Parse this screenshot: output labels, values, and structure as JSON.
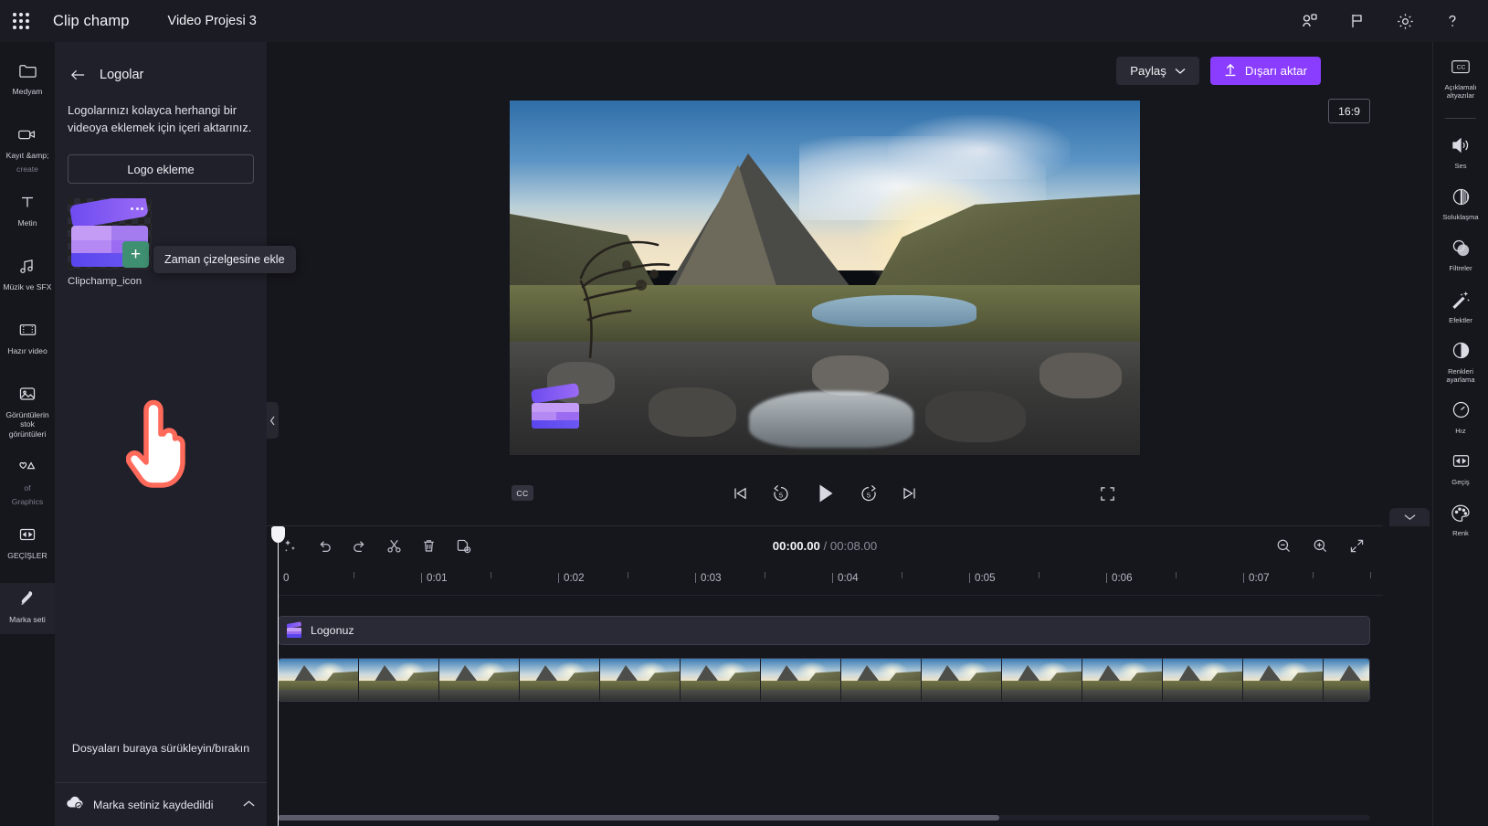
{
  "header": {
    "brand": "Clip champ",
    "project_name": "Video Projesi 3",
    "icons": [
      {
        "name": "collaborate-icon",
        "glyph": "share-people"
      },
      {
        "name": "flag-icon",
        "glyph": "flag"
      },
      {
        "name": "gear-icon",
        "glyph": "gear"
      },
      {
        "name": "help-icon",
        "glyph": "?"
      }
    ]
  },
  "left_rail": {
    "items": [
      {
        "label": "Medyam",
        "icon": "folder-icon",
        "active": false,
        "dim": false
      },
      {
        "label": "Kayıt &amp; create",
        "icon": "camera-icon",
        "active": false,
        "dim": true
      },
      {
        "label": "Metin",
        "icon": "text-icon",
        "active": false,
        "dim": false
      },
      {
        "label": "Müzik ve SFX",
        "icon": "music-icon",
        "active": false,
        "dim": false
      },
      {
        "label": "Hazır video",
        "icon": "film-icon",
        "active": false,
        "dim": false
      },
      {
        "label": "Görüntülerin stok görüntüleri",
        "icon": "image-icon",
        "active": false,
        "dim": false
      },
      {
        "label": "of Graphics",
        "icon": "shapes-icon",
        "active": false,
        "dim": true
      },
      {
        "label": "GEÇİŞLER",
        "icon": "transition-icon",
        "active": false,
        "dim": false
      },
      {
        "label": "Marka seti",
        "icon": "brandkit-icon",
        "active": true,
        "dim": false
      }
    ],
    "kayit_line1": "Kayıt &amp;",
    "kayit_line2": "create",
    "graphics_line1": "of",
    "graphics_line2": "Graphics"
  },
  "panel": {
    "title": "Logolar",
    "description": "Logolarınızı kolayca herhangi bir videoya eklemek için içeri aktarınız.",
    "add_logo_label": "Logo ekleme",
    "asset_name": "Clipchamp_icon",
    "tooltip": "Zaman çizelgesine ekle",
    "drop_hint": "Dosyaları buraya sürükleyin/bırakın",
    "brand_saved": "Marka setiniz kaydedildi"
  },
  "stage": {
    "share_label": "Paylaş",
    "export_label": "Dışarı aktar",
    "aspect_ratio": "16:9",
    "cc_label": "CC",
    "transport": [
      {
        "name": "skip-to-start-button"
      },
      {
        "name": "rewind-5s-button",
        "value": "5"
      },
      {
        "name": "play-button"
      },
      {
        "name": "forward-5s-button",
        "value": "5"
      },
      {
        "name": "skip-to-end-button"
      }
    ]
  },
  "right_rail": {
    "items": [
      {
        "label": "Açıklamalı altyazılar",
        "icon": "closed-caption-icon"
      },
      {
        "label": "Ses",
        "icon": "speaker-icon"
      },
      {
        "label": "Soluklaşma",
        "icon": "fade-icon"
      },
      {
        "label": "Filtreler",
        "icon": "filters-icon"
      },
      {
        "label": "Efektler",
        "icon": "effects-icon"
      },
      {
        "label": "Renkleri ayarlama",
        "icon": "adjust-colors-icon"
      },
      {
        "label": "Hız",
        "icon": "speed-icon"
      },
      {
        "label": "Geçiş",
        "icon": "transition-icon"
      },
      {
        "label": "Renk",
        "icon": "color-palette-icon"
      }
    ]
  },
  "timeline": {
    "current_time": "00:00.00",
    "separator": " / ",
    "total_time": "00:08.00",
    "tools": [
      {
        "name": "magic-tools-button"
      },
      {
        "name": "undo-button"
      },
      {
        "name": "redo-button"
      },
      {
        "name": "split-button"
      },
      {
        "name": "delete-button"
      },
      {
        "name": "duplicate-button"
      }
    ],
    "zoom_tools": [
      {
        "name": "zoom-out-button"
      },
      {
        "name": "zoom-in-button"
      },
      {
        "name": "fit-timeline-button"
      }
    ],
    "ruler_labels": [
      "0",
      "0:01",
      "0:02",
      "0:03",
      "0:04",
      "0:05",
      "0:06",
      "0:07"
    ],
    "logo_clip_label": "Logonuz",
    "video_frames": 14
  },
  "colors": {
    "accent": "#8b3dff",
    "panel_bg": "#20202a",
    "app_bg": "#16161d",
    "green_add": "#3f8f72",
    "cursor_outline": "#ff6a5a"
  }
}
